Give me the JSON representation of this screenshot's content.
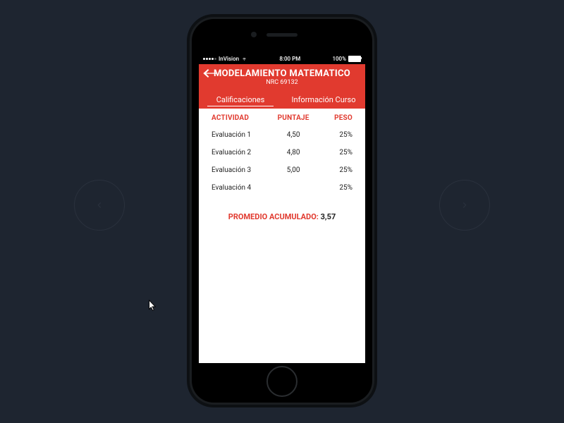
{
  "statusbar": {
    "carrier": "InVision",
    "time": "8:00 PM",
    "battery_pct": "100%"
  },
  "header": {
    "title": "MODELAMIENTO MATEMATICO",
    "subtitle": "NRC 69132"
  },
  "tabs": {
    "left": "Calificaciones",
    "right": "Información Curso"
  },
  "table": {
    "headers": {
      "activity": "ACTIVIDAD",
      "score": "PUNTAJE",
      "weight": "PESO"
    },
    "rows": [
      {
        "activity": "Evaluación 1",
        "score": "4,50",
        "weight": "25%"
      },
      {
        "activity": "Evaluación 2",
        "score": "4,80",
        "weight": "25%"
      },
      {
        "activity": "Evaluación 3",
        "score": "5,00",
        "weight": "25%"
      },
      {
        "activity": "Evaluación 4",
        "score": "",
        "weight": "25%"
      }
    ]
  },
  "average": {
    "label": "PROMEDIO ACUMULADO:",
    "value": "3,57"
  }
}
